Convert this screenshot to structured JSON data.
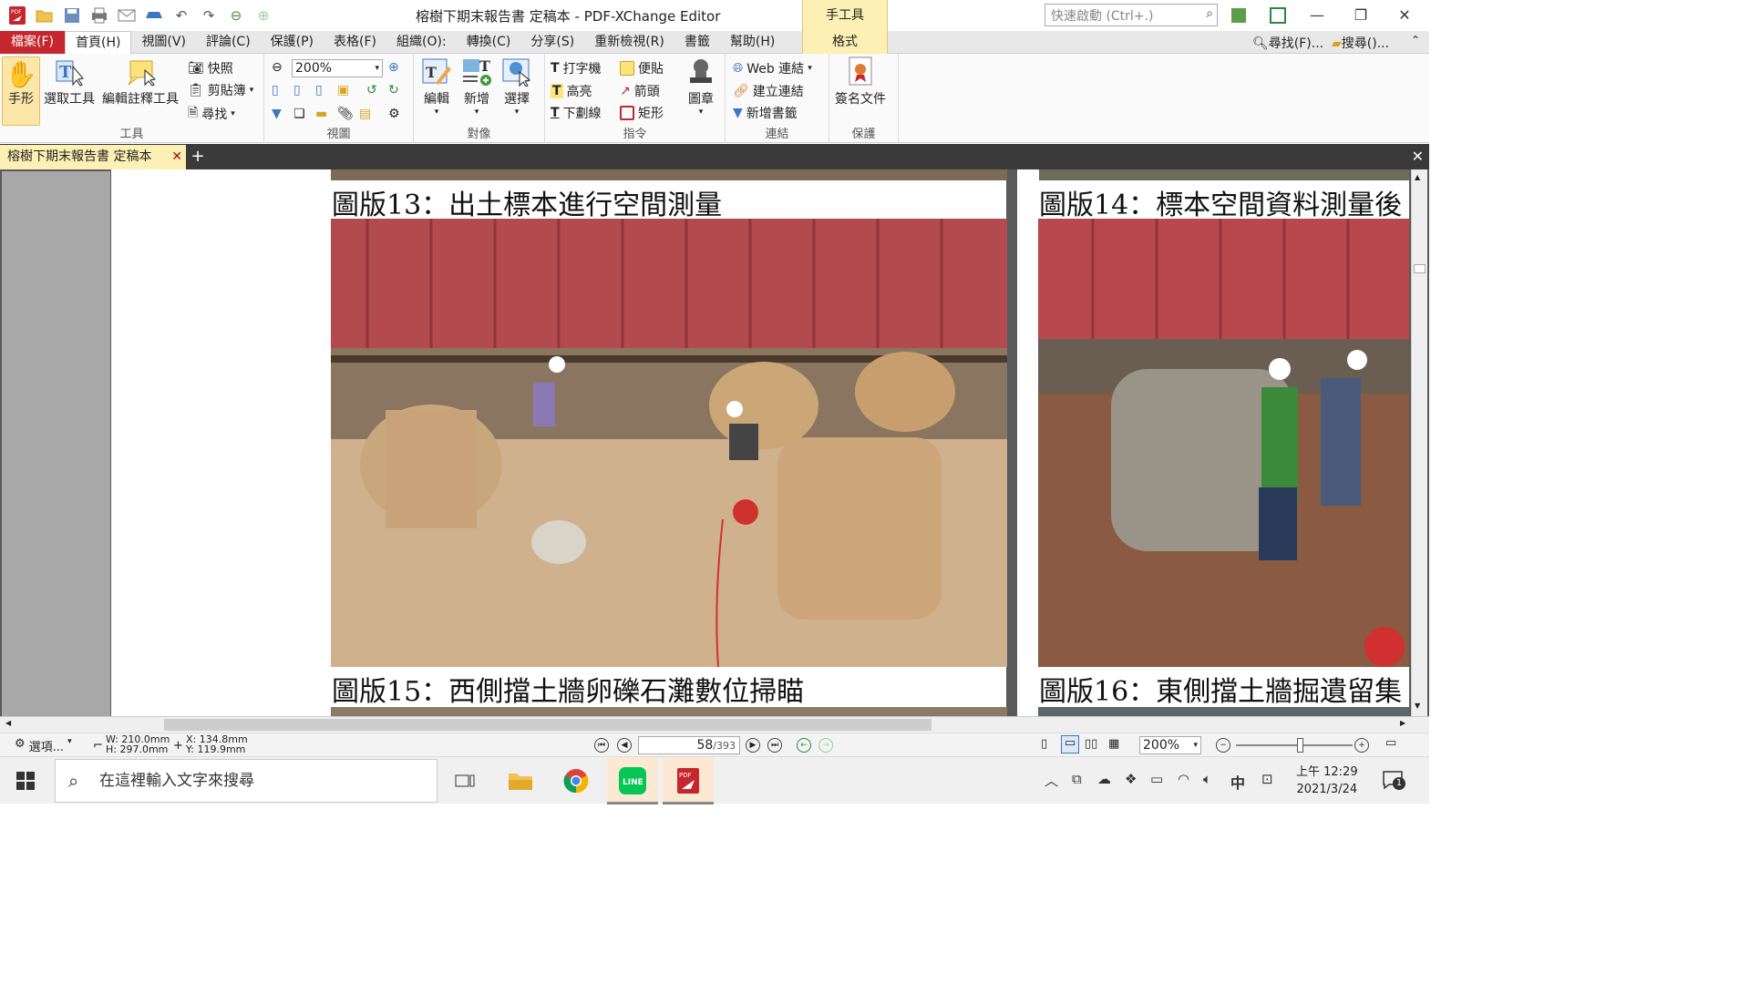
{
  "titlebar": {
    "title": "榕樹下期末報告書 定稿本 - PDF-XChange Editor",
    "context_tab": "手工具",
    "quick_launch_placeholder": "快速啟動 (Ctrl+.)"
  },
  "menu": {
    "file": "檔案(F)",
    "items": [
      "首頁(H)",
      "視圖(V)",
      "評論(C)",
      "保護(P)",
      "表格(F)",
      "組織(O):",
      "轉換(C)",
      "分享(S)",
      "重新檢視(R)",
      "書籤",
      "幫助(H)"
    ],
    "context_tab": "格式",
    "find": "尋找(F)...",
    "search": "搜尋()..."
  },
  "ribbon": {
    "tools": {
      "hand": "手形",
      "select": "選取工具",
      "edit_annot": "編輯註釋工具",
      "snapshot": "快照",
      "clipboard": "剪貼簿",
      "find": "尋找",
      "label": "工具"
    },
    "view": {
      "zoom": "200%",
      "label": "視圖"
    },
    "objects": {
      "edit": "編輯",
      "add": "新增",
      "select": "選擇",
      "label": "對像"
    },
    "commands": {
      "typewriter": "打字機",
      "sticky": "便貼",
      "highlight": "高亮",
      "arrow": "箭頭",
      "underline": "下劃線",
      "rect": "矩形",
      "stamp": "圖章",
      "label": "指令"
    },
    "links": {
      "web": "Web 連結",
      "create": "建立連結",
      "add_bookmark": "新增書籤",
      "label": "連結"
    },
    "protect": {
      "sign": "簽名文件",
      "label": "保護"
    }
  },
  "doc": {
    "tab_title": "榕樹下期末報告書 定稿本",
    "captions": {
      "p13": "圖版13：出土標本進行空間測量",
      "p14": "圖版14：標本空間資料測量後",
      "p15": "圖版15：西側擋土牆卵礫石灘數位掃瞄",
      "p16": "圖版16：東側擋土牆掘遺留集"
    }
  },
  "status": {
    "options": "選項...",
    "width": "W: 210.0mm",
    "height": "H: 297.0mm",
    "x": "X: 134.8mm",
    "y": "Y: 119.9mm",
    "page": "58",
    "total": "/393",
    "zoom": "200%"
  },
  "taskbar": {
    "search_placeholder": "在這裡輸入文字來搜尋",
    "time": "上午 12:29",
    "date": "2021/3/24",
    "ime": "中",
    "notifications": "1"
  }
}
